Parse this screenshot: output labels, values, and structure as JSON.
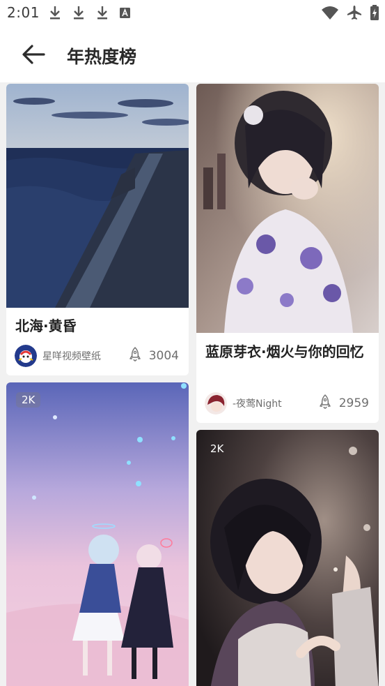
{
  "status_bar": {
    "time": "2:01",
    "left_icons": [
      "download-icon",
      "download-icon",
      "download-icon",
      "text-a-icon"
    ],
    "right_icons": [
      "wifi-icon",
      "airplane-icon",
      "battery-charging-icon"
    ]
  },
  "header": {
    "title": "年热度榜",
    "back_icon": "arrow-left-icon"
  },
  "cards": [
    {
      "title": "北海·黄昏",
      "author": "星咩视频壁纸",
      "likes": "3004",
      "badge": ""
    },
    {
      "title": "蓝原芽衣·烟火与你的回忆",
      "author": "-夜莺Night",
      "likes": "2959",
      "badge": ""
    },
    {
      "title": "",
      "author": "",
      "likes": "",
      "badge": "2K"
    },
    {
      "title": "",
      "author": "",
      "likes": "",
      "badge": "2K"
    }
  ],
  "colors": {
    "background": "#f1f1f1",
    "card": "#ffffff",
    "title_text": "#222222",
    "meta_text": "#6e6e6e"
  }
}
